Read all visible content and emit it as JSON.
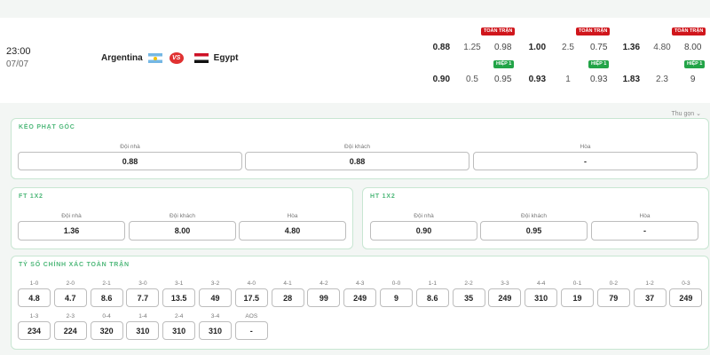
{
  "match": {
    "time": "23:00",
    "date": "07/07",
    "home_team": "Argentina",
    "away_team": "Egypt",
    "vs_label": "VS",
    "collapse_label": "Thu gọn",
    "markets": [
      {
        "full": {
          "tag": "TOÀN TRẬN",
          "values": [
            "0.88",
            "1.25",
            "0.98"
          ]
        },
        "half": {
          "tag": "HIỆP 1",
          "values": [
            "0.90",
            "0.5",
            "0.95"
          ]
        }
      },
      {
        "full": {
          "tag": "TOÀN TRẬN",
          "values": [
            "1.00",
            "2.5",
            "0.75"
          ]
        },
        "half": {
          "tag": "HIỆP 1",
          "values": [
            "0.93",
            "1",
            "0.93"
          ]
        }
      },
      {
        "full": {
          "tag": "TOÀN TRẬN",
          "values": [
            "1.36",
            "4.80",
            "8.00"
          ]
        },
        "half": {
          "tag": "HIỆP 1",
          "values": [
            "1.83",
            "2.3",
            "9"
          ]
        }
      }
    ]
  },
  "corner_kick": {
    "title": "KÈO PHẠT GÓC",
    "cells": [
      {
        "label": "Đội nhà",
        "value": "0.88"
      },
      {
        "label": "Đội khách",
        "value": "0.88"
      },
      {
        "label": "Hòa",
        "value": "-"
      }
    ]
  },
  "ft_1x2": {
    "title": "FT 1X2",
    "cells": [
      {
        "label": "Đội nhà",
        "value": "1.36"
      },
      {
        "label": "Đội khách",
        "value": "8.00"
      },
      {
        "label": "Hòa",
        "value": "4.80"
      }
    ]
  },
  "ht_1x2": {
    "title": "HT 1X2",
    "cells": [
      {
        "label": "Đội nhà",
        "value": "0.90"
      },
      {
        "label": "Đội khách",
        "value": "0.95"
      },
      {
        "label": "Hòa",
        "value": "-"
      }
    ]
  },
  "correct_score": {
    "title": "TỶ SỐ CHÍNH XÁC TOÀN TRẬN",
    "row1": [
      {
        "score": "1-0",
        "odds": "4.8"
      },
      {
        "score": "2-0",
        "odds": "4.7"
      },
      {
        "score": "2-1",
        "odds": "8.6"
      },
      {
        "score": "3-0",
        "odds": "7.7"
      },
      {
        "score": "3-1",
        "odds": "13.5"
      },
      {
        "score": "3-2",
        "odds": "49"
      },
      {
        "score": "4-0",
        "odds": "17.5"
      },
      {
        "score": "4-1",
        "odds": "28"
      },
      {
        "score": "4-2",
        "odds": "99"
      },
      {
        "score": "4-3",
        "odds": "249"
      },
      {
        "score": "0-0",
        "odds": "9"
      },
      {
        "score": "1-1",
        "odds": "8.6"
      },
      {
        "score": "2-2",
        "odds": "35"
      },
      {
        "score": "3-3",
        "odds": "249"
      },
      {
        "score": "4-4",
        "odds": "310"
      },
      {
        "score": "0-1",
        "odds": "19"
      },
      {
        "score": "0-2",
        "odds": "79"
      },
      {
        "score": "1-2",
        "odds": "37"
      },
      {
        "score": "0-3",
        "odds": "249"
      }
    ],
    "row2": [
      {
        "score": "1-3",
        "odds": "234"
      },
      {
        "score": "2-3",
        "odds": "224"
      },
      {
        "score": "0-4",
        "odds": "320"
      },
      {
        "score": "1-4",
        "odds": "310"
      },
      {
        "score": "2-4",
        "odds": "310"
      },
      {
        "score": "3-4",
        "odds": "310"
      },
      {
        "score": "AOS",
        "odds": "-"
      }
    ]
  }
}
